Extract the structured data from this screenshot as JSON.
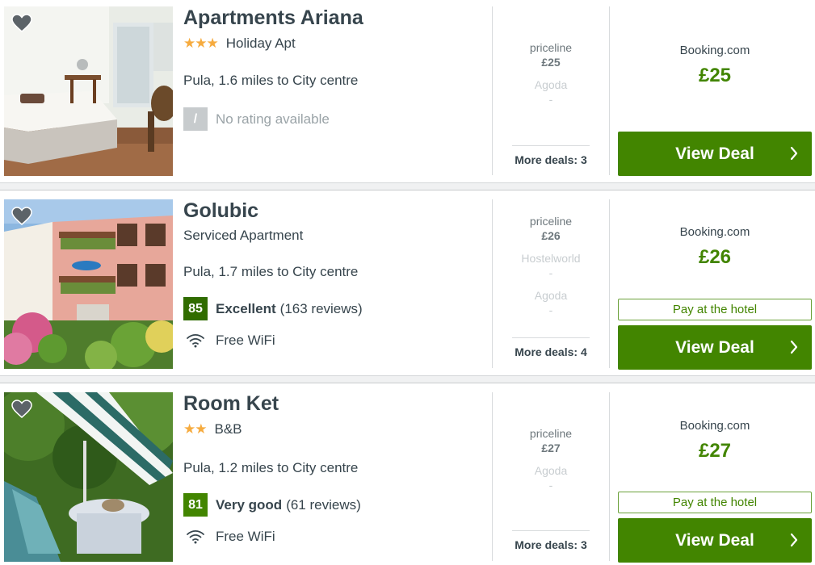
{
  "colors": {
    "accent_green": "#428500",
    "star_orange": "#f6ab3f",
    "text": "#37454d"
  },
  "results": [
    {
      "name": "Apartments Ariana",
      "stars": "★★★",
      "type": "Holiday Apt",
      "location": "Pula, 1.6 miles to City centre",
      "rating_score": "/",
      "rating_text": "No rating available",
      "other_deals": [
        {
          "provider": "priceline",
          "price": "£25"
        },
        {
          "provider": "Agoda",
          "price": "-"
        }
      ],
      "more_deals": "More deals: 3",
      "best_provider": "Booking.com",
      "best_price": "£25",
      "cta": "View Deal"
    },
    {
      "name": "Golubic",
      "type": "Serviced Apartment",
      "location": "Pula, 1.7 miles to City centre",
      "rating_score": "85",
      "rating_word": "Excellent",
      "rating_count": "(163 reviews)",
      "amenity": "Free WiFi",
      "other_deals": [
        {
          "provider": "priceline",
          "price": "£26"
        },
        {
          "provider": "Hostelworld",
          "price": "-"
        },
        {
          "provider": "Agoda",
          "price": "-"
        }
      ],
      "more_deals": "More deals: 4",
      "best_provider": "Booking.com",
      "best_price": "£26",
      "pay_note": "Pay at the hotel",
      "cta": "View Deal"
    },
    {
      "name": "Room Ket",
      "stars": "★★",
      "type": "B&B",
      "location": "Pula, 1.2 miles to City centre",
      "rating_score": "81",
      "rating_word": "Very good",
      "rating_count": "(61 reviews)",
      "amenity": "Free WiFi",
      "other_deals": [
        {
          "provider": "priceline",
          "price": "£27"
        },
        {
          "provider": "Agoda",
          "price": "-"
        }
      ],
      "more_deals": "More deals: 3",
      "best_provider": "Booking.com",
      "best_price": "£27",
      "pay_note": "Pay at the hotel",
      "cta": "View Deal"
    }
  ]
}
